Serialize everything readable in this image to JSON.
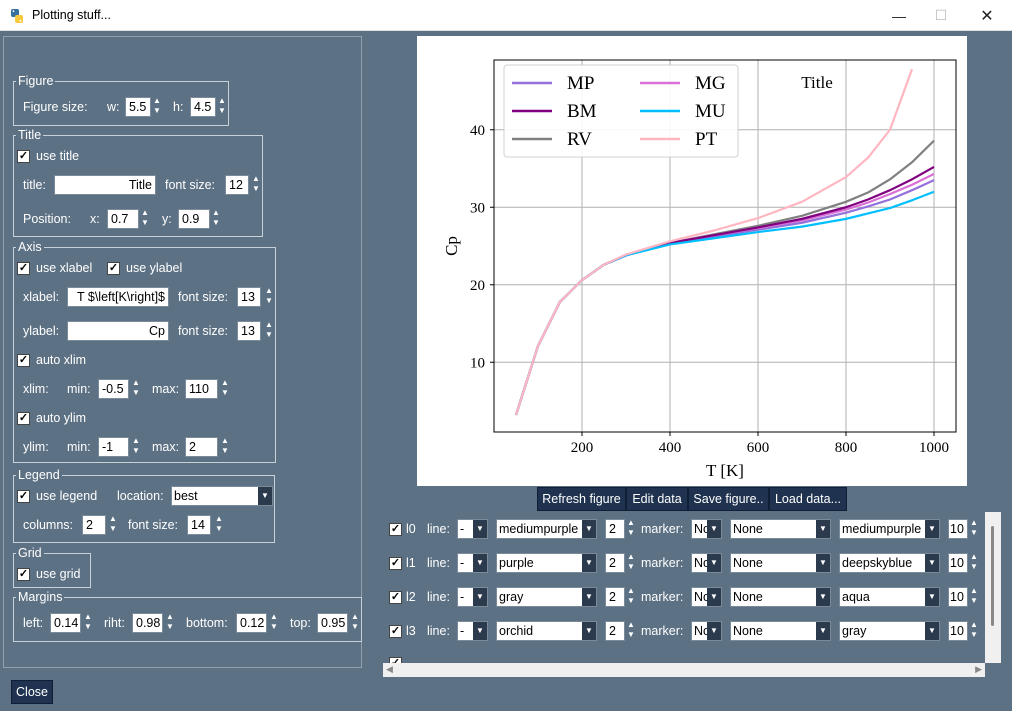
{
  "window": {
    "title": "Plotting stuff...",
    "minimize": "—",
    "maximize": "☐",
    "close": "✕"
  },
  "figure": {
    "legend": "Figure",
    "size_label": "Figure size:",
    "w_label": "w:",
    "w": "5.5",
    "h_label": "h:",
    "h": "4.5"
  },
  "title_section": {
    "legend": "Title",
    "use_title_label": "use title",
    "use_title": true,
    "title_label": "title:",
    "title_value": "Title",
    "font_size_label": "font size:",
    "font_size": "12",
    "position_label": "Position:",
    "x_label": "x:",
    "x": "0.7",
    "y_label": "y:",
    "y": "0.9"
  },
  "axis": {
    "legend": "Axis",
    "use_xlabel_label": "use xlabel",
    "use_ylabel_label": "use ylabel",
    "xlabel_label": "xlabel:",
    "xlabel_value": "T $\\left[K\\right]$",
    "xlabel_fs_label": "font size:",
    "xlabel_fs": "13",
    "ylabel_label": "ylabel:",
    "ylabel_value": "Cp",
    "ylabel_fs_label": "font size:",
    "ylabel_fs": "13",
    "auto_xlim_label": "auto xlim",
    "xlim_label": "xlim:",
    "xmin_label": "min:",
    "xmin": "-0.5",
    "xmax_label": "max:",
    "xmax": "110",
    "auto_ylim_label": "auto ylim",
    "ylim_label": "ylim:",
    "ymin_label": "min:",
    "ymin": "-1",
    "ymax_label": "max:",
    "ymax": "2"
  },
  "legend_section": {
    "legend": "Legend",
    "use_legend_label": "use legend",
    "location_label": "location:",
    "location": "best",
    "columns_label": "columns:",
    "columns": "2",
    "font_size_label": "font size:",
    "font_size": "14"
  },
  "grid_section": {
    "legend": "Grid",
    "use_grid_label": "use grid"
  },
  "margins": {
    "legend": "Margins",
    "left_label": "left:",
    "left": "0.14",
    "right_label": "riht:",
    "right": "0.98",
    "bottom_label": "bottom:",
    "bottom": "0.12",
    "top_label": "top:",
    "top": "0.95"
  },
  "close_button": "Close",
  "toolbar": {
    "refresh": "Refresh figure",
    "edit": "Edit data",
    "save": "Save figure..",
    "load": "Load data..."
  },
  "lines": [
    {
      "id": "l0",
      "line_label": "line:",
      "style": "-",
      "color": "mediumpurple",
      "width": "2",
      "marker_label": "marker:",
      "marker": "Nc",
      "marker_fill": "None",
      "marker_color": "mediumpurple",
      "size": "10"
    },
    {
      "id": "l1",
      "line_label": "line:",
      "style": "-",
      "color": "purple",
      "width": "2",
      "marker_label": "marker:",
      "marker": "Nc",
      "marker_fill": "None",
      "marker_color": "deepskyblue",
      "size": "10"
    },
    {
      "id": "l2",
      "line_label": "line:",
      "style": "-",
      "color": "gray",
      "width": "2",
      "marker_label": "marker:",
      "marker": "Nc",
      "marker_fill": "None",
      "marker_color": "aqua",
      "size": "10"
    },
    {
      "id": "l3",
      "line_label": "line:",
      "style": "-",
      "color": "orchid",
      "width": "2",
      "marker_label": "marker:",
      "marker": "Nc",
      "marker_fill": "None",
      "marker_color": "gray",
      "size": "10"
    }
  ],
  "chart_data": {
    "type": "line",
    "title": "Title",
    "xlabel": "T [K]",
    "ylabel": "Cp",
    "xlim": [
      0,
      1050
    ],
    "ylim": [
      1,
      49
    ],
    "xticks": [
      200,
      400,
      600,
      800,
      1000
    ],
    "yticks": [
      10,
      20,
      30,
      40
    ],
    "grid": true,
    "legend_position": "top-left",
    "x": [
      50,
      100,
      150,
      200,
      250,
      300,
      400,
      500,
      600,
      700,
      800,
      850,
      900,
      950,
      1000
    ],
    "series": [
      {
        "name": "MP",
        "color": "#9370db",
        "values": [
          3.2,
          12.1,
          17.8,
          20.6,
          22.6,
          23.8,
          25.3,
          26.2,
          27.1,
          28.0,
          29.3,
          30.1,
          31.0,
          32.2,
          33.5
        ]
      },
      {
        "name": "BM",
        "color": "#800080",
        "values": [
          3.2,
          12.1,
          17.8,
          20.6,
          22.6,
          23.8,
          25.4,
          26.4,
          27.4,
          28.5,
          30.0,
          31.0,
          32.2,
          33.6,
          35.2
        ]
      },
      {
        "name": "RV",
        "color": "#808080",
        "values": [
          3.2,
          12.1,
          17.8,
          20.6,
          22.6,
          23.8,
          25.4,
          26.5,
          27.6,
          28.9,
          30.7,
          31.9,
          33.6,
          35.8,
          38.6
        ]
      },
      {
        "name": "MG",
        "color": "#da70d6",
        "values": [
          3.2,
          12.1,
          17.8,
          20.6,
          22.6,
          23.8,
          25.4,
          26.4,
          27.3,
          28.3,
          29.7,
          30.6,
          31.7,
          32.9,
          34.3
        ]
      },
      {
        "name": "MU",
        "color": "#00bfff",
        "values": [
          3.2,
          12.1,
          17.8,
          20.6,
          22.6,
          23.8,
          25.2,
          26.0,
          26.8,
          27.5,
          28.5,
          29.2,
          29.9,
          30.9,
          32.0
        ]
      },
      {
        "name": "PT",
        "color": "#ffb6c1",
        "values": [
          3.2,
          12.1,
          17.8,
          20.6,
          22.6,
          23.9,
          25.6,
          27.0,
          28.6,
          30.7,
          33.9,
          36.4,
          40.0,
          47.8,
          null
        ]
      }
    ]
  }
}
